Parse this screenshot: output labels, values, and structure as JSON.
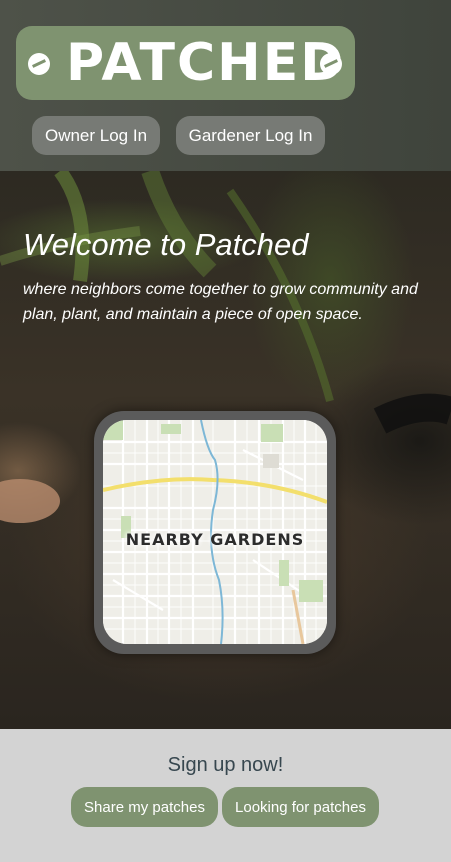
{
  "header": {
    "logo_text": "PATCHED",
    "owner_login": "Owner Log In",
    "gardener_login": "Gardener Log In"
  },
  "hero": {
    "title": "Welcome to Patched",
    "subtitle": "where neighbors come together to grow community and plan, plant, and maintain a piece of open space.",
    "map_label": "NEARBY GARDENS"
  },
  "footer": {
    "title": "Sign up now!",
    "share_button": "Share my patches",
    "looking_button": "Looking for patches"
  },
  "colors": {
    "brand_green": "#7f9370",
    "header_bg": "#4e5249",
    "nav_button": "#777a75",
    "footer_bg": "#d3d3d3"
  }
}
